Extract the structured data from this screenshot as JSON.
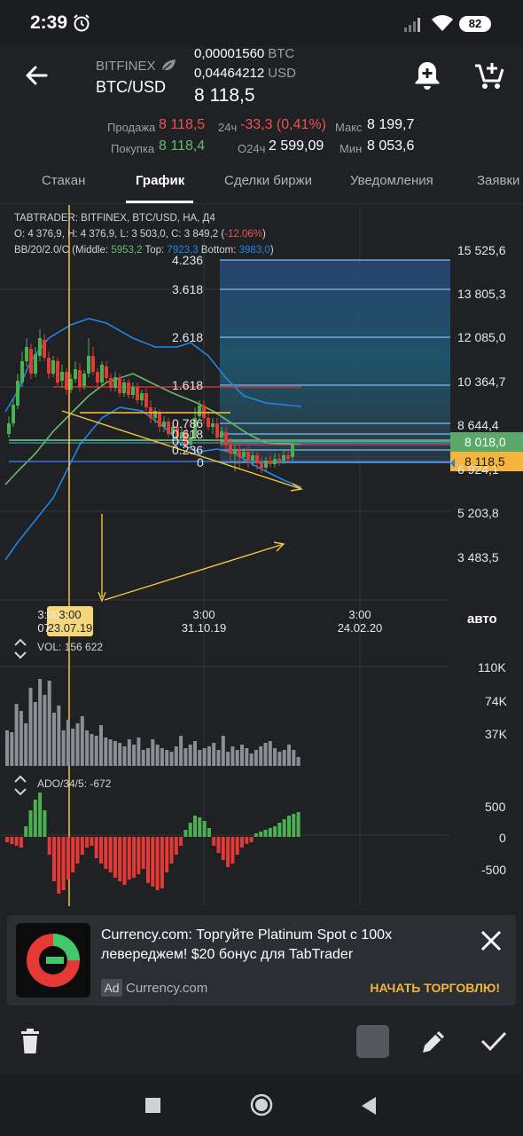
{
  "status": {
    "time": "2:39",
    "battery": "82"
  },
  "header": {
    "exchange": "BITFINEX",
    "pair": "BTC/USD",
    "balance_btc": "0,00001560",
    "balance_btc_unit": "BTC",
    "balance_usd": "0,04464212",
    "balance_usd_unit": "USD",
    "last_price": "8 118,5"
  },
  "stats": {
    "sell_label": "Продажа",
    "sell_value": "8 118,5",
    "buy_label": "Покупка",
    "buy_value": "8 118,4",
    "change_label": "24ч",
    "change_value": "-33,3 (0,41%)",
    "volume_label": "O24ч",
    "volume_value": "2 599,09",
    "max_label": "Макс",
    "max_value": "8 199,7",
    "min_label": "Мин",
    "min_value": "8 053,6"
  },
  "tabs": [
    "Стакан",
    "График",
    "Сделки биржи",
    "Уведомления",
    "Заявки"
  ],
  "chart": {
    "legend1": "TABTRADER: BITFINEX, BTC/USD, НА, Д4",
    "legend2": "O: 4 376,9, H: 4 376,9, L: 3 503,0, C: 3 849,2 (",
    "legend2_change": "-12.06%",
    "legend2_end": ")",
    "legend3": "BB/20/2.0/C (Middle: ",
    "bb_middle": "5953,2",
    "bb_top_label": " Top: ",
    "bb_top": "7923,3",
    "bb_bottom_label": " Bottom: ",
    "bb_bottom": "3983,0",
    "bb_end": ")",
    "price_labels": [
      "15 525,6",
      "13 805,3",
      "12 085,0",
      "10 364,7",
      "8 644,4",
      "6 924,1",
      "5 203,8",
      "3 483,5"
    ],
    "badge_green": "8 018,0",
    "badge_current": "8 118,5",
    "fib_levels": [
      "4.236",
      "3.618",
      "2.618",
      "1.618",
      "0.786",
      "0.618",
      "0.5",
      "0.236",
      "0"
    ],
    "time_labels": [
      {
        "t": "3:00",
        "d": "07.0"
      },
      {
        "t": "3:00",
        "d": "31.10.19"
      },
      {
        "t": "3:00",
        "d": "24.02.20"
      }
    ],
    "crosshair_time": "3:00",
    "crosshair_date": "23.07.19",
    "auto_label": "авто",
    "vol_label": "VOL: 156 622",
    "vol_axis": [
      "110K",
      "74K",
      "37K"
    ],
    "ado_label": "ADO/34/5: -672",
    "ado_axis": [
      "500",
      "0",
      "-500"
    ],
    "colors": {
      "up": "#4caf50",
      "down": "#e53935",
      "bb": "#1e88e5",
      "ma": "#66bb6a",
      "fib": "#6fa8dc",
      "accent": "#f5c542"
    }
  },
  "ad": {
    "title": "Currency.com: Торгуйте Platinum Spot с 100x левереджем! $20 бонус для TabTrader",
    "tag": "Ad",
    "site": "Currency.com",
    "cta": "НАЧАТЬ ТОРГОВЛЮ!"
  },
  "icons": {
    "back": "arrow-left-icon",
    "alert": "bell-plus-icon",
    "cart": "cart-plus-icon",
    "trash": "trash-icon",
    "pencil": "pencil-icon",
    "check": "check-icon",
    "close": "close-icon"
  }
}
